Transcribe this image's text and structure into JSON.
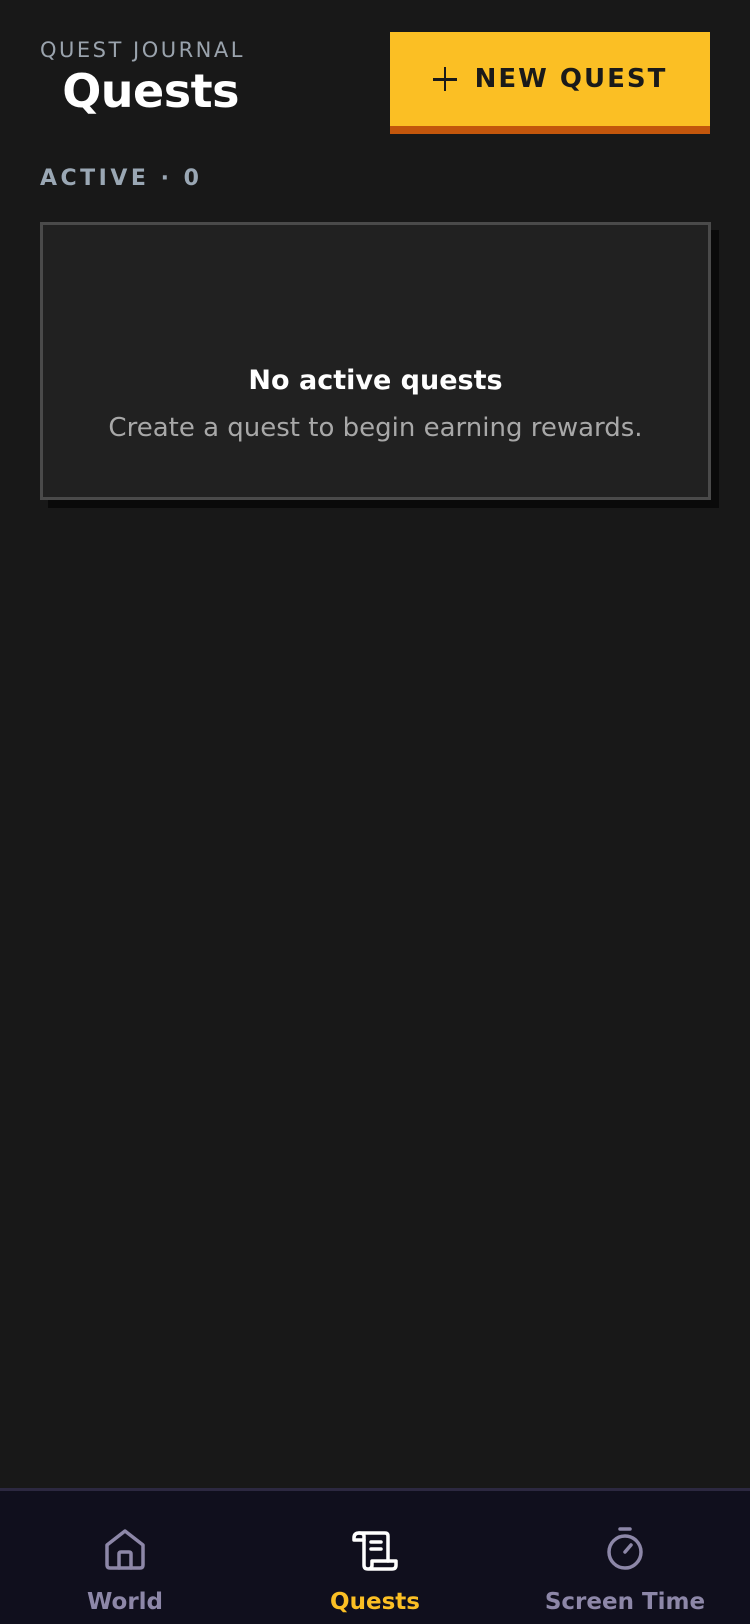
{
  "header": {
    "eyebrow": "QUEST JOURNAL",
    "title": "Quests",
    "new_quest_label": "NEW QUEST",
    "new_quest_icon": "plus-icon"
  },
  "active_section": {
    "label": "ACTIVE · 0",
    "count": 0
  },
  "empty_state": {
    "title": "No active quests",
    "subtitle": "Create a quest to begin earning rewards."
  },
  "bottom_nav": {
    "items": [
      {
        "label": "World",
        "icon": "home-icon",
        "active": false
      },
      {
        "label": "Quests",
        "icon": "scroll-icon",
        "active": true
      },
      {
        "label": "Screen Time",
        "icon": "stopwatch-icon",
        "active": false
      }
    ]
  },
  "colors": {
    "background": "#181818",
    "accent": "#fbbf24",
    "accent_shadow": "#c2560c",
    "nav_background": "#100f1d",
    "nav_inactive": "#8d87a8",
    "muted_text": "#9aa3ad"
  }
}
